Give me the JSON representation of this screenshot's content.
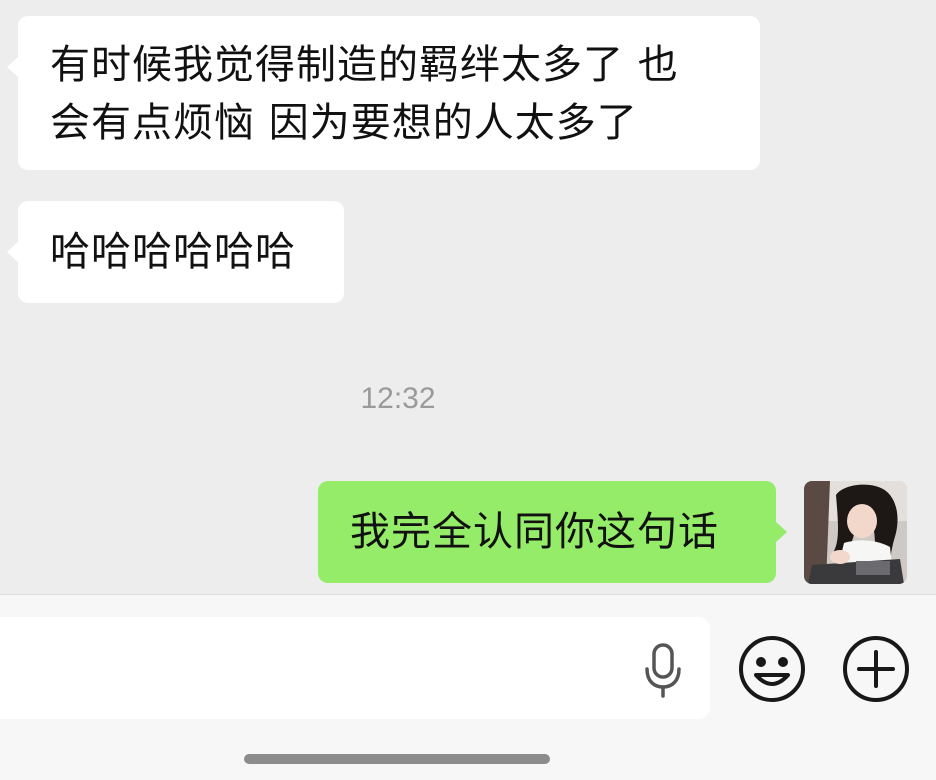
{
  "chat": {
    "messages": [
      {
        "sender": "other",
        "line1": "有时候我觉得制造的羁绊太多了 也",
        "line2": "会有点烦恼 因为要想的人太多了"
      },
      {
        "sender": "other",
        "text": "哈哈哈哈哈哈"
      },
      {
        "sender": "me",
        "text": "我完全认同你这句话"
      }
    ],
    "timestamp": "12:32"
  },
  "input_bar": {
    "value": "",
    "placeholder": ""
  },
  "colors": {
    "background": "#ededed",
    "incoming_bubble": "#ffffff",
    "outgoing_bubble": "#95ec69",
    "timestamp_text": "#9a9a9a"
  },
  "icons": {
    "voice": "microphone-icon",
    "emoji": "smiley-icon",
    "more": "plus-icon"
  }
}
